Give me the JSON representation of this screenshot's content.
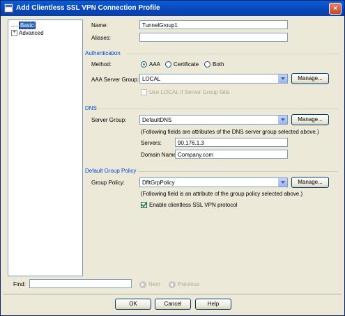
{
  "window": {
    "title": "Add Clientless SSL VPN Connection Profile",
    "close_label": "×"
  },
  "tree": {
    "items": [
      {
        "label": "Basic",
        "expander": ""
      },
      {
        "label": "Advanced",
        "expander": "+"
      }
    ]
  },
  "basic": {
    "name_label": "Name:",
    "name_value": "TunnelGroup1",
    "aliases_label": "Aliases:",
    "aliases_value": ""
  },
  "authentication": {
    "section": "Authentication",
    "method_label": "Method:",
    "methods": [
      "AAA",
      "Certificate",
      "Both"
    ],
    "selected_method": "AAA",
    "server_group_label": "AAA Server Group:",
    "server_group_value": "LOCAL",
    "manage_label": "Manage...",
    "fallback_label": "Use LOCAL if Server Group fails",
    "fallback_checked": false
  },
  "dns": {
    "section": "DNS",
    "server_group_label": "Server Group:",
    "server_group_value": "DefaultDNS",
    "manage_label": "Manage...",
    "note": "(Following fields are attributes of the DNS server group selected above.)",
    "servers_label": "Servers:",
    "servers_value": "90.176.1.3",
    "domain_label": "Domain Name:",
    "domain_value": "Company.com"
  },
  "group_policy": {
    "section": "Default Group Policy",
    "policy_label": "Group Policy:",
    "policy_value": "DfltGrpPolicy",
    "manage_label": "Manage...",
    "note": "(Following field is an attribute of the group policy selected above.)",
    "enable_label": "Enable clientless SSL VPN protocol",
    "enable_checked": true
  },
  "find": {
    "label": "Find:",
    "value": "",
    "next_label": "Next",
    "previous_label": "Previous"
  },
  "buttons": {
    "ok": "OK",
    "cancel": "Cancel",
    "help": "Help"
  },
  "colors": {
    "title_bar": "#0a5fd8",
    "section_header": "#0046d5",
    "dialog_bg": "#ece9d8",
    "selection": "#316ac5"
  },
  "icons": {
    "title": "window-icon",
    "next": "next-arrow-icon",
    "previous": "previous-arrow-icon"
  }
}
